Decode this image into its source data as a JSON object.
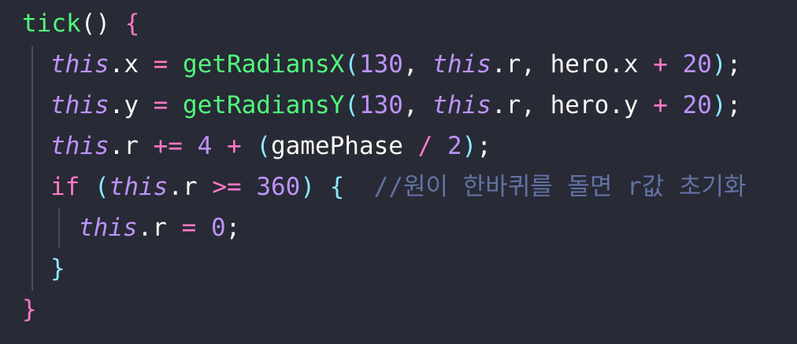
{
  "code": {
    "l1": {
      "name": "tick",
      "parens": "()",
      "open": "{"
    },
    "l2": {
      "this": "this",
      "prop": ".x",
      "assign": " = ",
      "fn": "getRadiansX",
      "lp": "(",
      "n1": "130",
      "sep1": ", ",
      "this2": "this",
      "prop2": ".r",
      "sep2": ", ",
      "arg": "hero.x",
      "plus": " + ",
      "n2": "20",
      "rp": ")",
      "semi": ";"
    },
    "l3": {
      "this": "this",
      "prop": ".y",
      "assign": " = ",
      "fn": "getRadiansY",
      "lp": "(",
      "n1": "130",
      "sep1": ", ",
      "this2": "this",
      "prop2": ".r",
      "sep2": ", ",
      "arg": "hero.y",
      "plus": " + ",
      "n2": "20",
      "rp": ")",
      "semi": ";"
    },
    "l4": {
      "this": "this",
      "prop": ".r",
      "op": " += ",
      "n1": "4",
      "plus": " + ",
      "lp": "(",
      "var": "gamePhase",
      "div": " / ",
      "n2": "2",
      "rp": ")",
      "semi": ";"
    },
    "l5": {
      "kw": "if",
      "sp": " ",
      "lp": "(",
      "this": "this",
      "prop": ".r",
      "op": " >= ",
      "n1": "360",
      "rp": ")",
      "sp2": " ",
      "open": "{",
      "gap": "  ",
      "comment": "//원이 한바퀴를 돌면 r값 초기화"
    },
    "l6": {
      "this": "this",
      "prop": ".r",
      "assign": " = ",
      "n1": "0",
      "semi": ";"
    },
    "l7": {
      "close": "}"
    },
    "l8": {
      "close": "}"
    }
  },
  "colors": {
    "background": "#282a36",
    "keyword": "#ff79c6",
    "function": "#50fa7b",
    "this": "#bd93f9",
    "number": "#bd93f9",
    "comment": "#6272a4",
    "text": "#f8f8f2"
  }
}
